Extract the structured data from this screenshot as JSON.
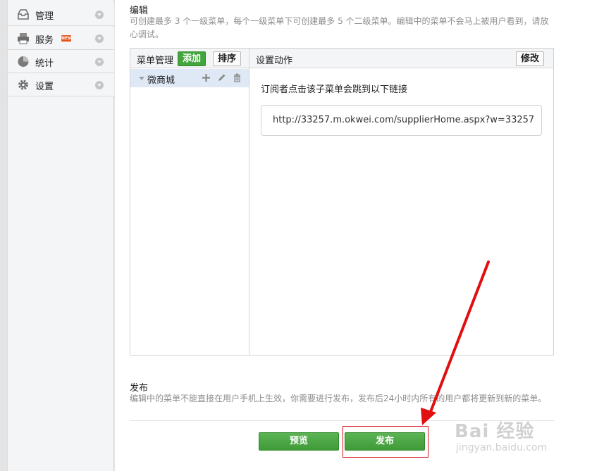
{
  "sidebar": {
    "items": [
      {
        "label": "管理",
        "icon": "inbox-icon"
      },
      {
        "label": "服务",
        "icon": "printer-icon",
        "badge": "NEW"
      },
      {
        "label": "统计",
        "icon": "pie-chart-icon"
      },
      {
        "label": "设置",
        "icon": "gear-icon"
      }
    ]
  },
  "edit": {
    "title": "编辑",
    "desc_line1": "可创建最多 3 个一级菜单，每个一级菜单下可创建最多 5 个二级菜单。编辑中的菜单不会马上被用户看到，请放",
    "desc_line2": "心调试。"
  },
  "menu_manager": {
    "title": "菜单管理",
    "add_label": "添加",
    "sort_label": "排序",
    "items": [
      {
        "label": "微商城"
      }
    ]
  },
  "action": {
    "title": "设置动作",
    "modify_label": "修改",
    "text": "订阅者点击该子菜单会跳到以下链接",
    "link": "http://33257.m.okwei.com/supplierHome.aspx?w=33257"
  },
  "publish": {
    "title": "发布",
    "desc": "编辑中的菜单不能直接在用户手机上生效，你需要进行发布，发布后24小时内所有的用户都将更新到新的菜单。",
    "preview_label": "预览",
    "publish_label": "发布"
  },
  "watermark": {
    "logo": "Bai 经验",
    "sub": "jingyan.baidu.com"
  },
  "colors": {
    "green": "#44a43e",
    "highlight_red": "#d5121a",
    "badge_orange": "#e8541e"
  }
}
